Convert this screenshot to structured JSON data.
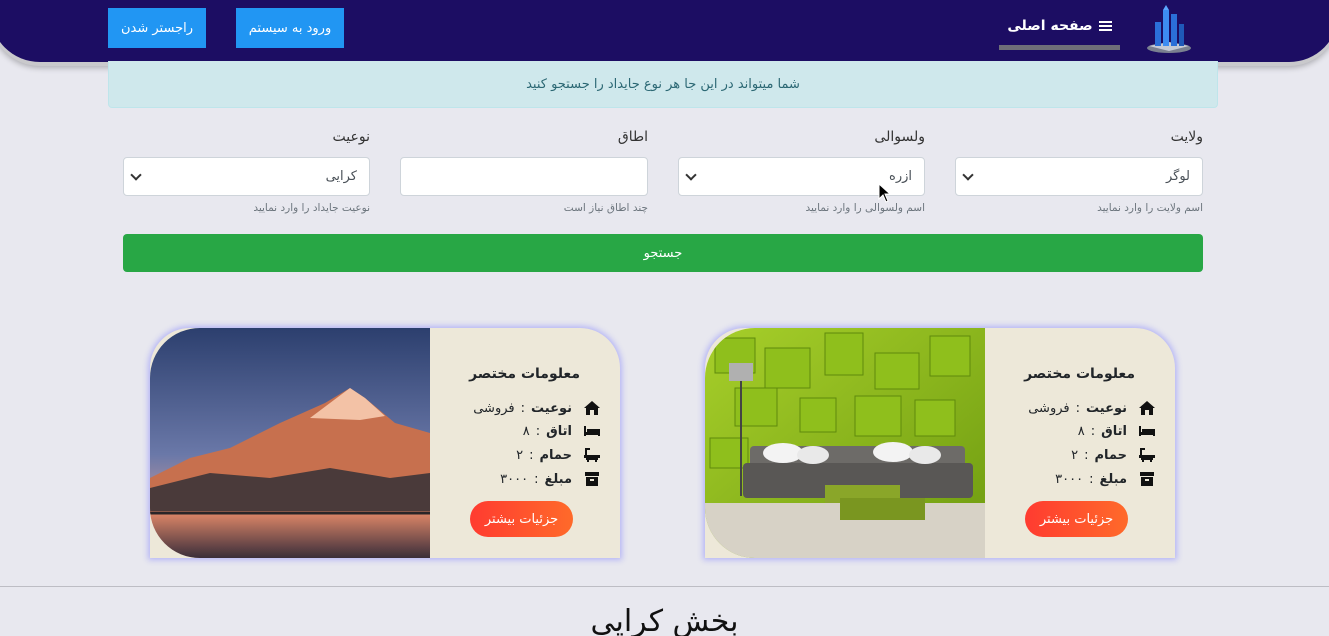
{
  "header": {
    "register_label": "راجستر شدن",
    "login_label": "ورود به سیستم",
    "home_label": "صفحه اصلی",
    "brand_color": "#1c0d63",
    "icons": {
      "menu": "menu-icon",
      "logo": "building-logo"
    }
  },
  "alert": {
    "text": "شما میتواند در این جا هر نوع جایداد را جستجو کنید"
  },
  "form": {
    "province": {
      "label": "ولایت",
      "value": "لوگر",
      "help": "اسم ولایت را وارد نمایید"
    },
    "district": {
      "label": "ولسوالی",
      "value": "ازره",
      "help": "اسم ولسوالی را وارد نمایید"
    },
    "rooms": {
      "label": "اطاق",
      "value": "",
      "help": "چند اطاق نیاز است"
    },
    "type": {
      "label": "نوعیت",
      "value": "کرایی",
      "help": "نوعیت جایداد را وارد نمایید"
    },
    "search_label": "جستجو",
    "search_color": "#28a745"
  },
  "cards": [
    {
      "title": "معلومات مختصر",
      "type_key": "نوعیت",
      "type_value": "فروشی",
      "rooms_key": "اتاق",
      "rooms_value": "۸",
      "bath_key": "حمام",
      "bath_value": "۲",
      "price_key": "مبلغ",
      "price_value": "۳۰۰۰",
      "details_label": "جزئیات بیشتر",
      "image": "living-room-green-wall"
    },
    {
      "title": "معلومات مختصر",
      "type_key": "نوعیت",
      "type_value": "فروشی",
      "rooms_key": "اتاق",
      "rooms_value": "۸",
      "bath_key": "حمام",
      "bath_value": "۲",
      "price_key": "مبلغ",
      "price_value": "۳۰۰۰",
      "details_label": "جزئیات بیشتر",
      "image": "mountain-lake-sunset"
    }
  ],
  "section": {
    "title": "بخش کرایی"
  }
}
